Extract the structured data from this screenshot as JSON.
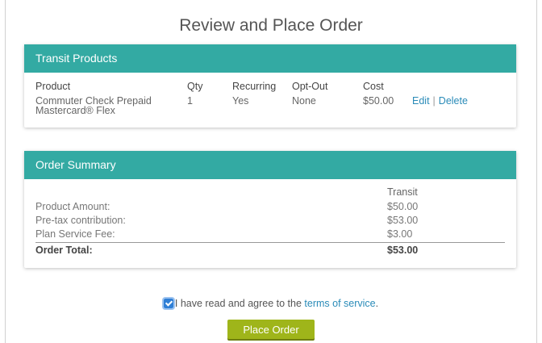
{
  "page": {
    "title": "Review and Place Order"
  },
  "transit": {
    "header": "Transit Products",
    "columns": {
      "product": "Product",
      "qty": "Qty",
      "recurring": "Recurring",
      "opt_out": "Opt-Out",
      "cost": "Cost"
    },
    "row": {
      "product": "Commuter Check Prepaid Mastercard® Flex",
      "qty": "1",
      "recurring": "Yes",
      "opt_out": "None",
      "cost": "$50.00",
      "edit": "Edit",
      "separator": "|",
      "delete": "Delete"
    }
  },
  "summary": {
    "header": "Order Summary",
    "column": "Transit",
    "rows": [
      {
        "label": "Product Amount:",
        "value": "$50.00"
      },
      {
        "label": "Pre-tax contribution:",
        "value": "$53.00"
      },
      {
        "label": "Plan Service Fee:",
        "value": "$3.00"
      }
    ],
    "total": {
      "label": "Order Total:",
      "value": "$53.00"
    }
  },
  "agreement": {
    "checked": true,
    "text": "I have read and agree to the ",
    "link": "terms of service",
    "suffix": "."
  },
  "actions": {
    "place_order": "Place Order"
  },
  "colors": {
    "header": "#33aaa3",
    "button": "#9fb51a",
    "link": "#2a8bb8"
  }
}
